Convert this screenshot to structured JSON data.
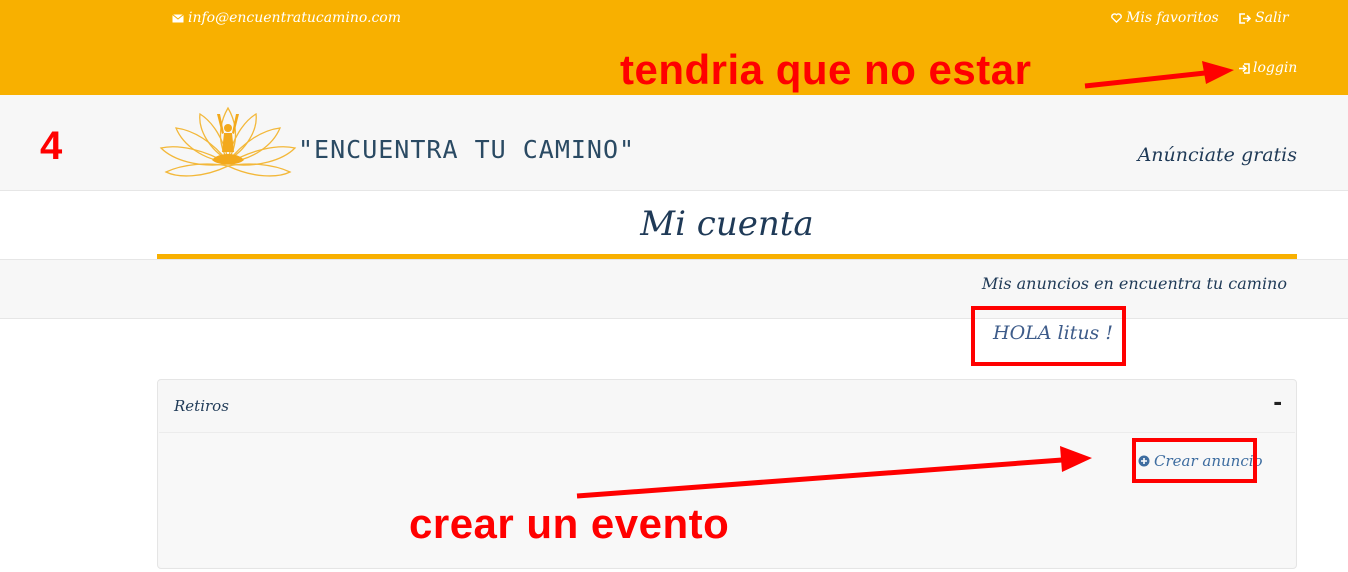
{
  "topbar": {
    "email": "info@encuentratucamino.com",
    "favorites": "Mis favoritos",
    "logout": "Salir",
    "login": "loggin",
    "bg_color": "#f8b000"
  },
  "header": {
    "brand": "\"ENCUENTRA TU CAMINO\"",
    "cta": "Anúnciate gratis"
  },
  "page": {
    "title": "Mi cuenta",
    "subnav_link": "Mis anuncios en encuentra tu camino",
    "greeting": "HOLA litus !"
  },
  "panel": {
    "title": "Retiros",
    "toggle": "-",
    "create_label": "Crear anuncio"
  },
  "annotations": {
    "note_top": "tendria que no estar",
    "note_bottom": "crear un evento",
    "step_number": "4",
    "color": "#ff0000"
  },
  "icons": [
    "envelope-icon",
    "heart-icon",
    "logout-icon",
    "login-icon",
    "plus-circle-icon",
    "lotus-logo"
  ]
}
